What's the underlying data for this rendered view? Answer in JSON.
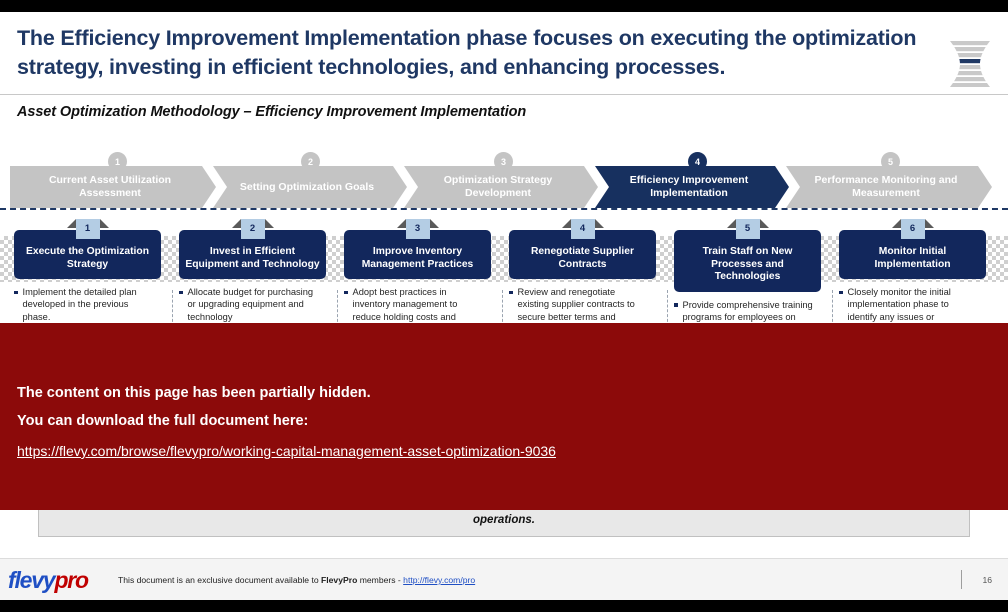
{
  "header": {
    "headline": "The Efficiency Improvement Implementation phase focuses on executing the optimization strategy, investing in efficient technologies, and enhancing processes.",
    "logo_icon": "spool-hourglass-icon",
    "accent_color": "#1F3864"
  },
  "subtitle": "Asset Optimization Methodology – Efficiency Improvement Implementation",
  "process": {
    "active_index": 3,
    "steps": [
      {
        "number": "1",
        "label": "Current Asset Utilization Assessment",
        "state": "inactive"
      },
      {
        "number": "2",
        "label": "Setting Optimization Goals",
        "state": "inactive"
      },
      {
        "number": "3",
        "label": "Optimization Strategy Development",
        "state": "inactive"
      },
      {
        "number": "4",
        "label": "Efficiency Improvement Implementation",
        "state": "active"
      },
      {
        "number": "5",
        "label": "Performance Monitoring and Measurement",
        "state": "inactive"
      }
    ],
    "inactive_color": "#C4C4C4",
    "active_color": "#17305F"
  },
  "cards": [
    {
      "number": "1",
      "title": "Execute the Optimization Strategy",
      "bullet": "Implement the detailed plan developed in the previous phase."
    },
    {
      "number": "2",
      "title": "Invest in Efficient Equipment and Technology",
      "bullet": "Allocate budget for purchasing or upgrading equipment and technology"
    },
    {
      "number": "3",
      "title": "Improve Inventory Management Practices",
      "bullet": "Adopt best practices in inventory management to reduce holding costs and"
    },
    {
      "number": "4",
      "title": "Renegotiate Supplier Contracts",
      "bullet": "Review and renegotiate existing supplier contracts to secure better terms and"
    },
    {
      "number": "5",
      "title": "Train Staff on New Processes and Technologies",
      "bullet": "Provide comprehensive training programs for employees on new"
    },
    {
      "number": "6",
      "title": "Monitor Initial Implementation",
      "bullet": "Closely monitor the initial implementation phase to identify any issues or"
    }
  ],
  "overlay": {
    "line1": "The content on this page has been partially hidden.",
    "line2": "You can download the full document here:",
    "link": "https://flevy.com/browse/flevypro/working-capital-management-asset-optimization-9036",
    "background_color": "#8C0A0A"
  },
  "bottom_box": {
    "text": "operations."
  },
  "footer": {
    "logo_primary": "flevy",
    "logo_secondary": "pro",
    "note_before": "This document is an exclusive document available to ",
    "note_brand": "FlevyPro",
    "note_after": " members - ",
    "note_link": "http://flevy.com/pro",
    "page_number": "16"
  }
}
